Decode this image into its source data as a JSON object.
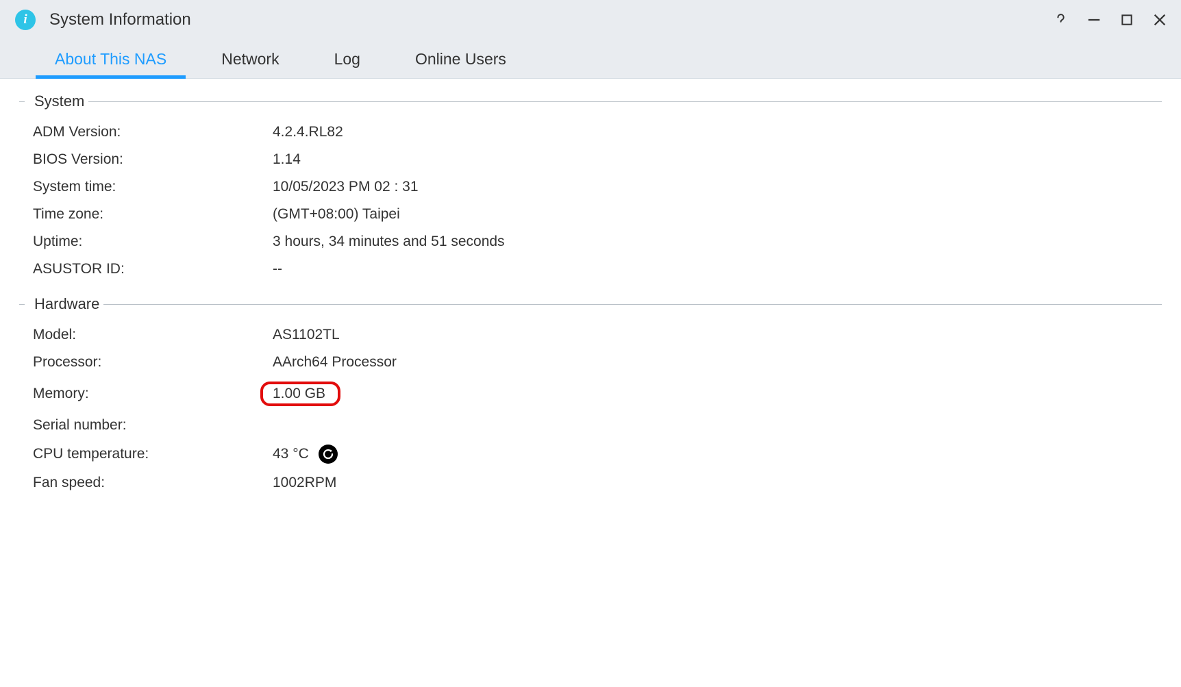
{
  "window": {
    "title": "System Information"
  },
  "tabs": [
    {
      "label": "About This NAS",
      "active": true
    },
    {
      "label": "Network",
      "active": false
    },
    {
      "label": "Log",
      "active": false
    },
    {
      "label": "Online Users",
      "active": false
    }
  ],
  "sections": {
    "system": {
      "title": "System",
      "adm_version_label": "ADM Version:",
      "adm_version_value": "4.2.4.RL82",
      "bios_version_label": "BIOS Version:",
      "bios_version_value": "1.14",
      "system_time_label": "System time:",
      "system_time_value": "10/05/2023  PM 02 : 31",
      "time_zone_label": "Time zone:",
      "time_zone_value": "(GMT+08:00) Taipei",
      "uptime_label": "Uptime:",
      "uptime_value": "3 hours, 34 minutes and 51 seconds",
      "asustor_id_label": "ASUSTOR ID:",
      "asustor_id_value": "--"
    },
    "hardware": {
      "title": "Hardware",
      "model_label": "Model:",
      "model_value": "AS1102TL",
      "processor_label": "Processor:",
      "processor_value": "AArch64 Processor",
      "memory_label": "Memory:",
      "memory_value": "1.00 GB",
      "serial_label": "Serial number:",
      "serial_value": "",
      "cpu_temp_label": "CPU temperature:",
      "cpu_temp_value": "43 °C",
      "fan_speed_label": "Fan speed:",
      "fan_speed_value": "1002RPM"
    }
  }
}
